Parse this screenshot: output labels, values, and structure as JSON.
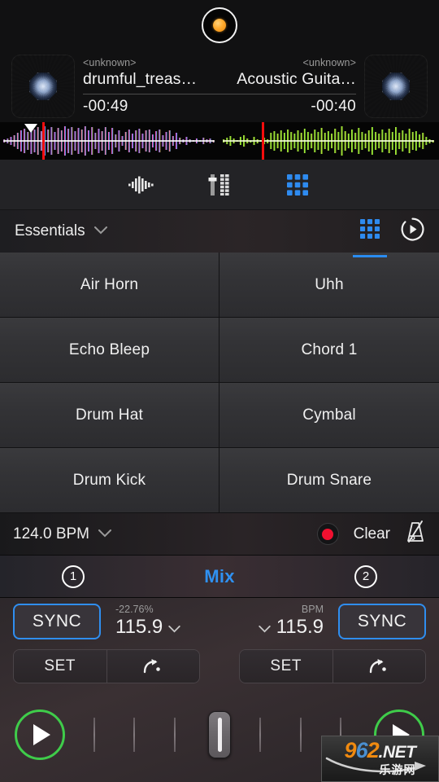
{
  "app": {
    "logo_icon": "vinyl-record-icon",
    "accent_blue": "#2a8cf0",
    "accent_green": "#3fcc4a",
    "accent_red": "#f40d0d",
    "background": "#0a0a0a"
  },
  "decks": {
    "left": {
      "artist": "<unknown>",
      "title": "drumful_treas…",
      "time_remaining": "-00:49",
      "artwork_icon": "album-art-icon",
      "waveform_colors": [
        "#c03ce0",
        "#ff66c4",
        "#3a7df0",
        "#ffd24a"
      ],
      "playhead_percent": 21,
      "cue_marker_percent": 15
    },
    "right": {
      "artist": "<unknown>",
      "title": "Acoustic Guita…",
      "time_remaining": "-00:40",
      "artwork_icon": "album-art-icon",
      "waveform_colors": [
        "#9ee03c",
        "#d8f04a",
        "#4aa81e",
        "#f0a02a"
      ],
      "playhead_percent": 20
    }
  },
  "toolbar": {
    "items": [
      {
        "icon": "waveform-icon",
        "label": "Waveform",
        "active": false
      },
      {
        "icon": "mixer-fader-icon",
        "label": "Mixer",
        "active": false
      },
      {
        "icon": "pad-grid-icon",
        "label": "Pads",
        "active": true
      }
    ]
  },
  "pads_header": {
    "pack_name": "Essentials",
    "dropdown_icon": "chevron-down-icon",
    "grid_icon": "pad-grid-icon",
    "loop_icon": "play-circle-icon"
  },
  "pads": [
    {
      "label": "Air Horn"
    },
    {
      "label": "Uhh"
    },
    {
      "label": "Echo Bleep"
    },
    {
      "label": "Chord 1"
    },
    {
      "label": "Drum Hat"
    },
    {
      "label": "Cymbal"
    },
    {
      "label": "Drum Kick"
    },
    {
      "label": "Drum Snare"
    }
  ],
  "bpm_bar": {
    "bpm_label": "124.0 BPM",
    "dropdown_icon": "chevron-down-icon",
    "record_icon": "record-button-icon",
    "clear_label": "Clear",
    "metronome_icon": "metronome-off-icon"
  },
  "mix_bar": {
    "deck_one": "1",
    "mix_label": "Mix",
    "deck_two": "2"
  },
  "controls": {
    "left": {
      "sync_label": "SYNC",
      "tempo_percent": "-22.76%",
      "tempo_bpm": "115.9",
      "tempo_dropdown_icon": "chevron-down-icon",
      "set_label": "SET",
      "cue_icon": "jump-to-cue-icon",
      "play_icon": "play-icon"
    },
    "right": {
      "sync_label": "SYNC",
      "tempo_unit": "BPM",
      "tempo_bpm": "115.9",
      "tempo_dropdown_icon": "chevron-down-icon",
      "set_label": "SET",
      "cue_icon": "jump-to-cue-icon",
      "play_icon": "play-icon"
    },
    "crossfader": {
      "ticks": 7,
      "position_percent": 50
    }
  },
  "watermark": {
    "digit_9": "9",
    "digit_6": "6",
    "digit_2": "2",
    "tld": ".NET",
    "subtitle": "乐游网"
  }
}
